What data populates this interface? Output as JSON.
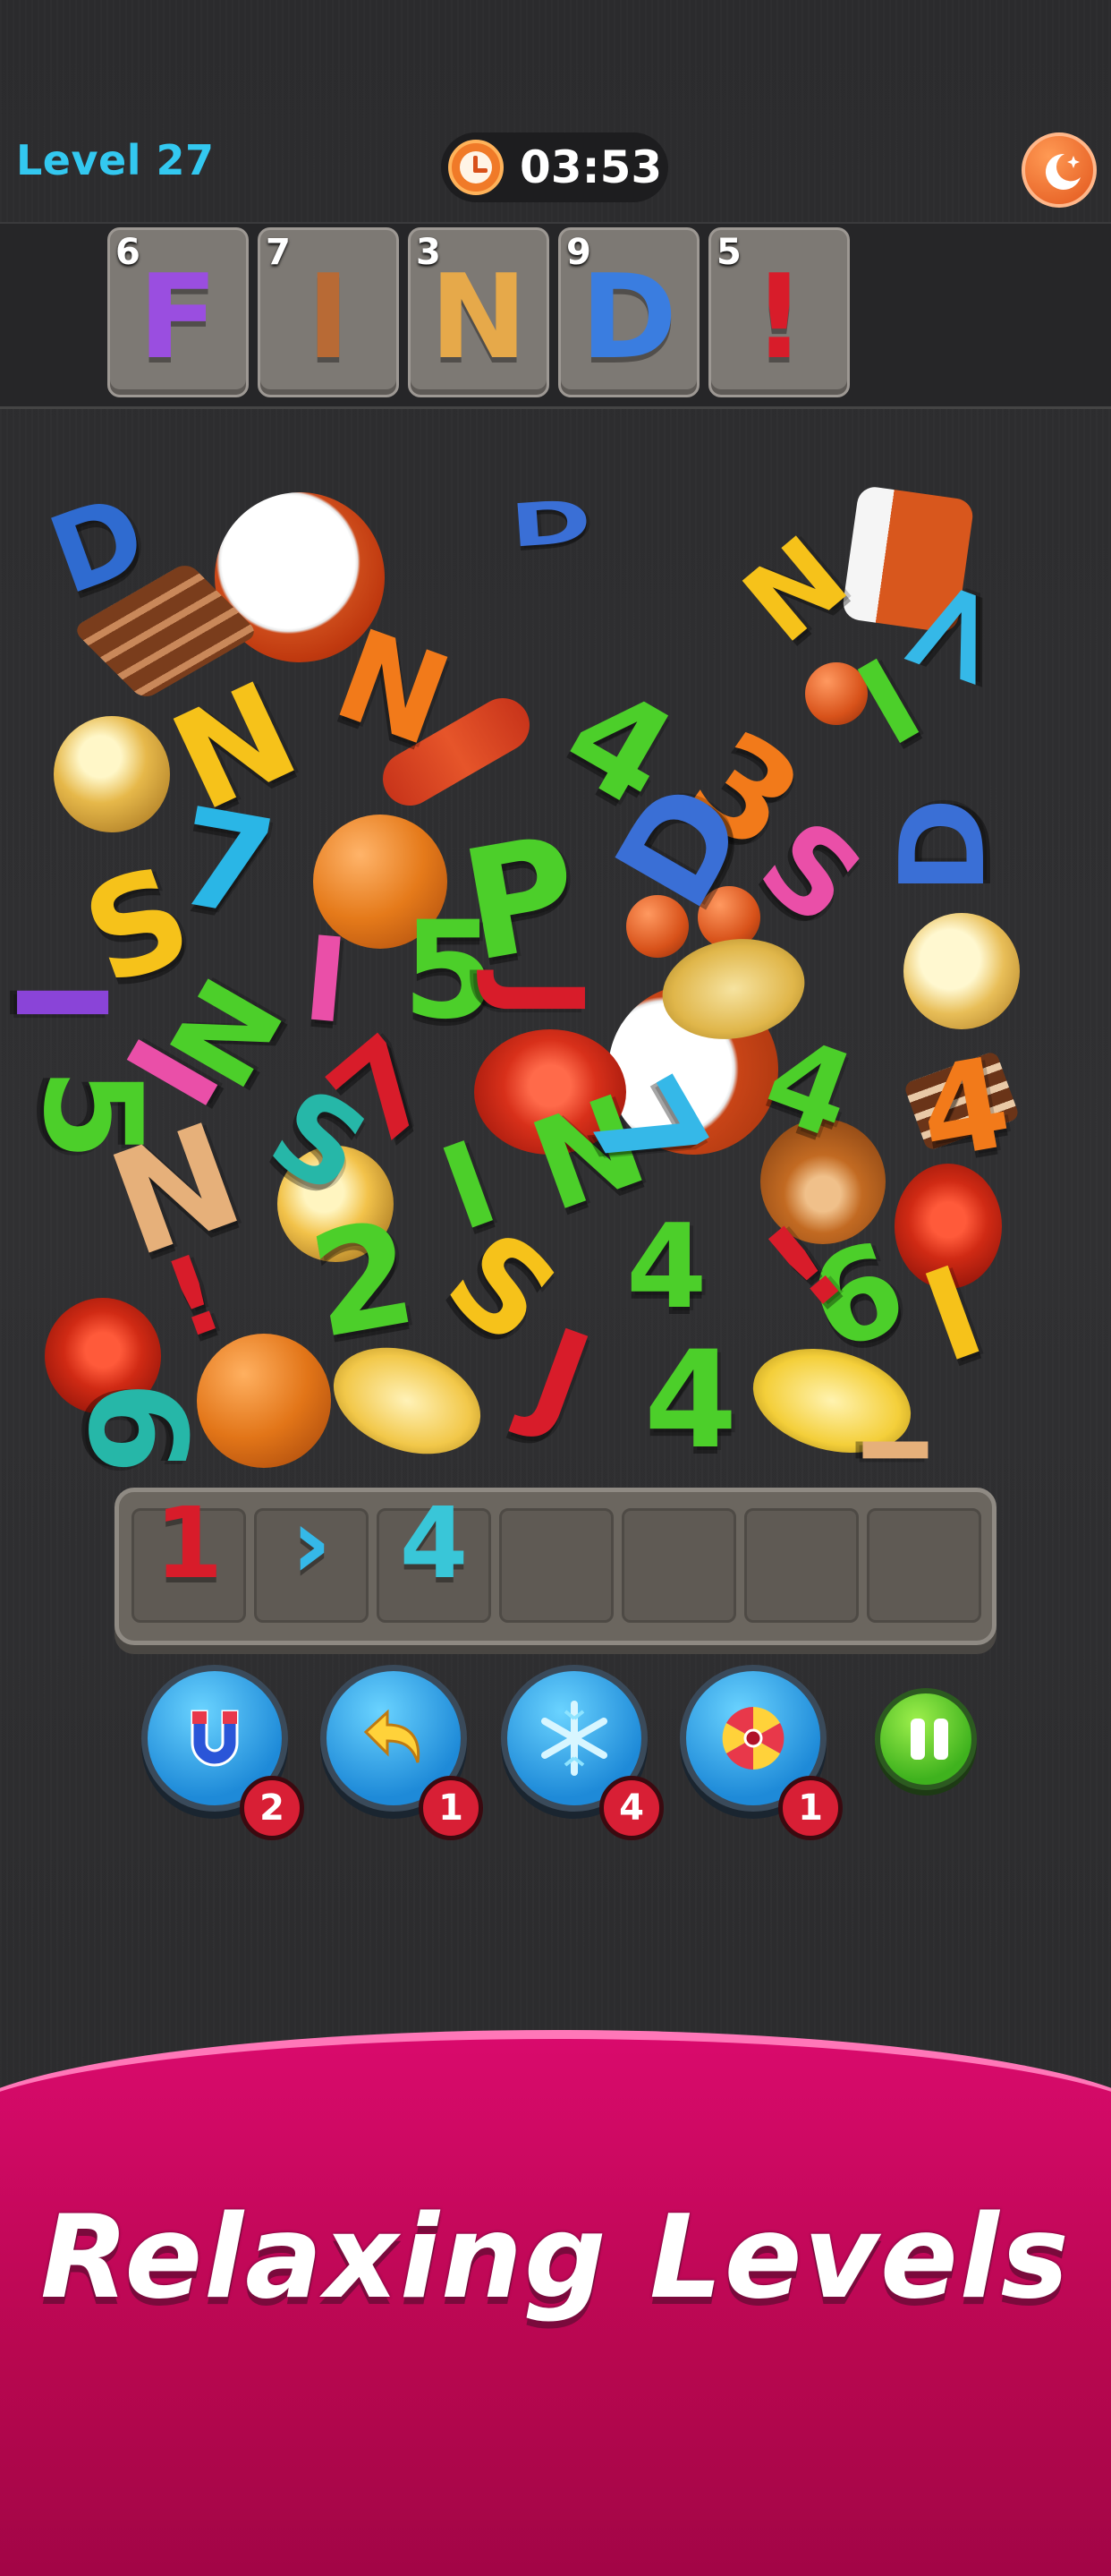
{
  "header": {
    "level_label": "Level 27",
    "timer": "03:53",
    "clock_icon": "clock-icon",
    "night_icon": "moon-stars-icon"
  },
  "find_tiles": [
    {
      "count": "6",
      "letter": "F",
      "color": "#9a4ee0"
    },
    {
      "count": "7",
      "letter": "I",
      "color": "#b86a35"
    },
    {
      "count": "3",
      "letter": "N",
      "color": "#e6a94a"
    },
    {
      "count": "9",
      "letter": "D",
      "color": "#3a7de0"
    },
    {
      "count": "5",
      "letter": "!",
      "color": "#d81c2a"
    }
  ],
  "tray": {
    "slots": [
      "1",
      "›",
      "4",
      "",
      "",
      "",
      ""
    ],
    "slot_colors": [
      "#d81c2a",
      "#35b8e8",
      "#39c6d8",
      "",
      "",
      "",
      ""
    ]
  },
  "boosters": [
    {
      "name": "magnet",
      "icon": "magnet-icon",
      "count": "2"
    },
    {
      "name": "undo",
      "icon": "undo-arrow-icon",
      "count": "1"
    },
    {
      "name": "freeze",
      "icon": "snowflake-icon",
      "count": "4"
    },
    {
      "name": "shuffle",
      "icon": "fan-icon",
      "count": "1"
    }
  ],
  "pause_icon": "pause-icon",
  "banner": {
    "text": "Relaxing Levels"
  },
  "colors": {
    "level_text": "#33c8f0",
    "banner": "#d90a6c",
    "booster_blue": "#1e8ad8",
    "badge_red": "#d81f35",
    "pause_green": "#3fb21e"
  }
}
